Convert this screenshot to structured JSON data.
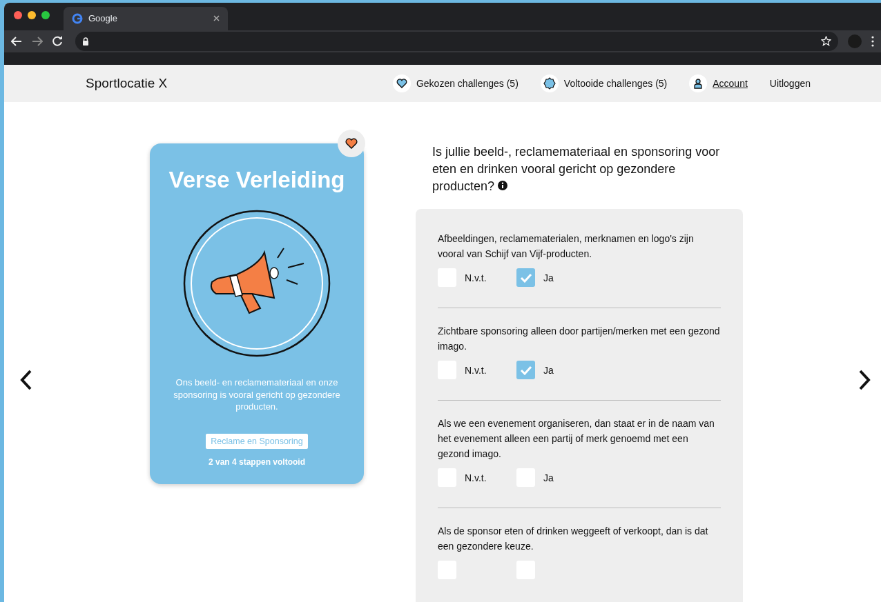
{
  "browser": {
    "tab_title": "Google"
  },
  "header": {
    "brand": "Sportlocatie X",
    "nav": [
      {
        "kind": "heart",
        "label": "Gekozen challenges (5)",
        "selected": false
      },
      {
        "kind": "badge",
        "label": "Voltooide challenges (5)",
        "selected": false
      },
      {
        "kind": "user",
        "label": "Account",
        "selected": true
      },
      {
        "kind": "plain",
        "label": "Uitloggen",
        "selected": false
      }
    ]
  },
  "card": {
    "title": "Verse Verleiding",
    "favorite": true,
    "description": "Ons beeld- en reclamemateriaal en onze sponsoring is vooral gericht op gezondere producten.",
    "tag": "Reclame en Sponsoring",
    "progress": "2 van 4 stappen voltooid"
  },
  "question": "Is jullie beeld-, reclamemateriaal en sponsoring voor eten en drinken vooral gericht op gezondere producten?",
  "items": [
    {
      "text": "Afbeeldingen, reclamematerialen, merknamen en logo's zijn vooral van Schijf van Vijf-producten.",
      "options": [
        {
          "label": "N.v.t.",
          "checked": false
        },
        {
          "label": "Ja",
          "checked": true
        }
      ]
    },
    {
      "text": "Zichtbare sponsoring alleen door partijen/merken met een gezond imago.",
      "options": [
        {
          "label": "N.v.t.",
          "checked": false
        },
        {
          "label": "Ja",
          "checked": true
        }
      ]
    },
    {
      "text": "Als we een evenement organiseren, dan staat er in de naam van het evenement alleen een partij of merk genoemd met een gezond imago.",
      "options": [
        {
          "label": "N.v.t.",
          "checked": false
        },
        {
          "label": "Ja",
          "checked": false
        }
      ]
    },
    {
      "text": "Als de sponsor eten of drinken weggeeft of verkoopt, dan is dat een gezondere keuze.",
      "options": [
        {
          "checked": false
        },
        {
          "checked": false
        }
      ]
    }
  ]
}
